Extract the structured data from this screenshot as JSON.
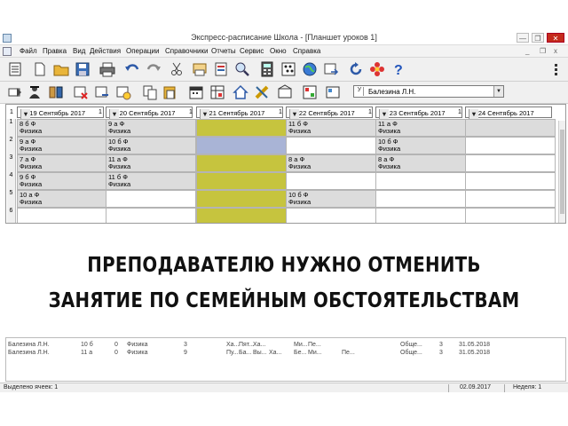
{
  "window": {
    "title": "Экспресс-расписание Школа - [Планшет уроков 1]",
    "buttons": [
      "—",
      "❐",
      "✕"
    ],
    "mdi_buttons": [
      "_",
      "❐",
      "x"
    ]
  },
  "menu": {
    "items": [
      "Файл",
      "Правка",
      "Вид",
      "Действия",
      "Операции",
      "Справочники",
      "Отчеты",
      "Сервис",
      "Окно",
      "Справка"
    ]
  },
  "toolbar1": {
    "icons": [
      "list-icon",
      "open-folder-icon",
      "save-icon",
      "print-icon",
      "undo-icon",
      "redo-icon",
      "print-preview-icon",
      "report-icon",
      "search-glass-icon",
      "calculator-icon",
      "abacus-icon",
      "globe-icon",
      "export-icon",
      "refresh-icon",
      "flower-icon",
      "help-icon"
    ]
  },
  "toolbar2": {
    "icons": [
      "arrow-icon",
      "teacher-icon",
      "group-icon",
      "delete-lesson-icon",
      "move-lesson-icon",
      "clock-icon",
      "copy-icon",
      "paste-icon",
      "calendar-icon",
      "schedule-icon",
      "home-icon",
      "ruler-icon",
      "room-icon",
      "grid-icon"
    ],
    "teacher": {
      "prefix": "У",
      "value": "Балезина Л.Н."
    }
  },
  "days": [
    {
      "num": "1",
      "label": "Вт 19 Сентябрь 2017"
    },
    {
      "num": "1",
      "label": "Ср 20 Сентябрь 2017"
    },
    {
      "num": "1",
      "label": "Чт 21 Сентябрь 2017"
    },
    {
      "num": "1",
      "label": "Пт 22 Сентябрь 2017"
    },
    {
      "num": "1",
      "label": "Сб 23 Сентябрь 2017"
    },
    {
      "num": "1",
      "label": "Вс 24 Сентябрь 2017"
    }
  ],
  "rows": [
    {
      "n": "1",
      "cells": [
        {
          "l1": "8 б   Ф",
          "l2": "Физика",
          "s": "g"
        },
        {
          "l1": "9 а   Ф",
          "l2": "Физика",
          "s": "g"
        },
        {
          "l1": "",
          "l2": "",
          "s": "o"
        },
        {
          "l1": "11 б   Ф",
          "l2": "Физика",
          "s": "g"
        },
        {
          "l1": "11 а   Ф",
          "l2": "Физика",
          "s": "g"
        },
        {
          "l1": "",
          "l2": "",
          "s": "g"
        }
      ]
    },
    {
      "n": "2",
      "cells": [
        {
          "l1": "9 а   Ф",
          "l2": "Физика",
          "s": "g"
        },
        {
          "l1": "10 б   Ф",
          "l2": "Физика",
          "s": "g"
        },
        {
          "l1": "",
          "l2": "",
          "s": "b"
        },
        {
          "l1": "",
          "l2": "",
          "s": "w"
        },
        {
          "l1": "10 б   Ф",
          "l2": "Физика",
          "s": "g"
        },
        {
          "l1": "",
          "l2": "",
          "s": "w"
        }
      ]
    },
    {
      "n": "3",
      "cells": [
        {
          "l1": "7 а   Ф",
          "l2": "Физика",
          "s": "g"
        },
        {
          "l1": "11 а   Ф",
          "l2": "Физика",
          "s": "g"
        },
        {
          "l1": "",
          "l2": "",
          "s": "o"
        },
        {
          "l1": "8 а   Ф",
          "l2": "Физика",
          "s": "g"
        },
        {
          "l1": "8 а   Ф",
          "l2": "Физика",
          "s": "g"
        },
        {
          "l1": "",
          "l2": "",
          "s": "w"
        }
      ]
    },
    {
      "n": "4",
      "cells": [
        {
          "l1": "9 б   Ф",
          "l2": "Физика",
          "s": "g"
        },
        {
          "l1": "11 б   Ф",
          "l2": "Физика",
          "s": "g"
        },
        {
          "l1": "",
          "l2": "",
          "s": "o"
        },
        {
          "l1": "",
          "l2": "",
          "s": "w"
        },
        {
          "l1": "",
          "l2": "",
          "s": "w"
        },
        {
          "l1": "",
          "l2": "",
          "s": "w"
        }
      ]
    },
    {
      "n": "5",
      "cells": [
        {
          "l1": "10 а   Ф",
          "l2": "Физика",
          "s": "g"
        },
        {
          "l1": "",
          "l2": "",
          "s": "w"
        },
        {
          "l1": "",
          "l2": "",
          "s": "o"
        },
        {
          "l1": "10 б   Ф",
          "l2": "Физика",
          "s": "g"
        },
        {
          "l1": "",
          "l2": "",
          "s": "w"
        },
        {
          "l1": "",
          "l2": "",
          "s": "w"
        }
      ]
    },
    {
      "n": "6",
      "cells": [
        {
          "l1": "",
          "l2": "",
          "s": "w"
        },
        {
          "l1": "",
          "l2": "",
          "s": "w"
        },
        {
          "l1": "",
          "l2": "",
          "s": "o"
        },
        {
          "l1": "",
          "l2": "",
          "s": "w"
        },
        {
          "l1": "",
          "l2": "",
          "s": "w"
        },
        {
          "l1": "",
          "l2": "",
          "s": "w"
        }
      ]
    }
  ],
  "overlay": {
    "line1": "ПРЕПОДАВАТЕЛЮ НУЖНО ОТМЕНИТЬ",
    "line2": "ЗАНЯТИЕ ПО СЕМЕЙНЫМ ОБСТОЯТЕЛЬСТВАМ"
  },
  "bottom_rows": [
    [
      "Балезина Л.Н.",
      "10 б",
      "0",
      "Физика",
      "3",
      "Ха...",
      "Пят...",
      "Ха...",
      "",
      "Ми...",
      "Пе...",
      "",
      "Обще...",
      "3",
      "31.05.2018"
    ],
    [
      "Балезина Л.Н.",
      "11 а",
      "0",
      "Физика",
      "9",
      "Пу...",
      "Ба...",
      "Вы...",
      "Ха...",
      "Бе...",
      "Ми...",
      "Пе...",
      "Обще...",
      "3",
      "31.05.2018"
    ]
  ],
  "status": {
    "selected": "Выделено ячеек: 1",
    "date": "02.09.2017",
    "week": "Неделя: 1"
  }
}
